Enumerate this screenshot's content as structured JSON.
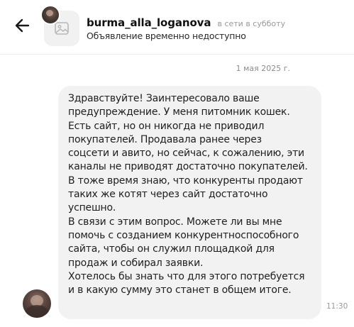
{
  "header": {
    "seller_name": "burma_alla_loganova",
    "online_status": "в сети в субботу",
    "listing_status": "Объявление временно недоступно"
  },
  "chat": {
    "date": "1 мая 2025 г.",
    "message_lines": [
      "Здравствуйте! Заинтересовало ваше",
      "предупреждение. У меня питомник кошек.",
      "Есть сайт, но он никогда не приводил",
      "покупателей. Продавала ранее через",
      "соцсети и авито, но сейчас, к сожалению, эти",
      "каналы не приводят достаточно покупателей.",
      "В тоже время знаю, что конкуренты продают",
      "таких же котят через сайт достаточно",
      "успешно.",
      "В связи с этим вопрос. Можете ли вы мне",
      "помочь с созданием конкурентноспособного",
      "сайта, чтобы он служил площадкой для",
      "продаж и собирал заявки.",
      "Хотелось бы знать что для этого потребуется",
      "и в какую сумму это станет в общем итоге."
    ],
    "message_time": "11:30"
  },
  "icons": {
    "back": "arrow-left-icon",
    "thumbnail": "image-placeholder-icon"
  },
  "colors": {
    "bubble": "#f2f2f2",
    "muted_text": "#9a9a9a"
  }
}
